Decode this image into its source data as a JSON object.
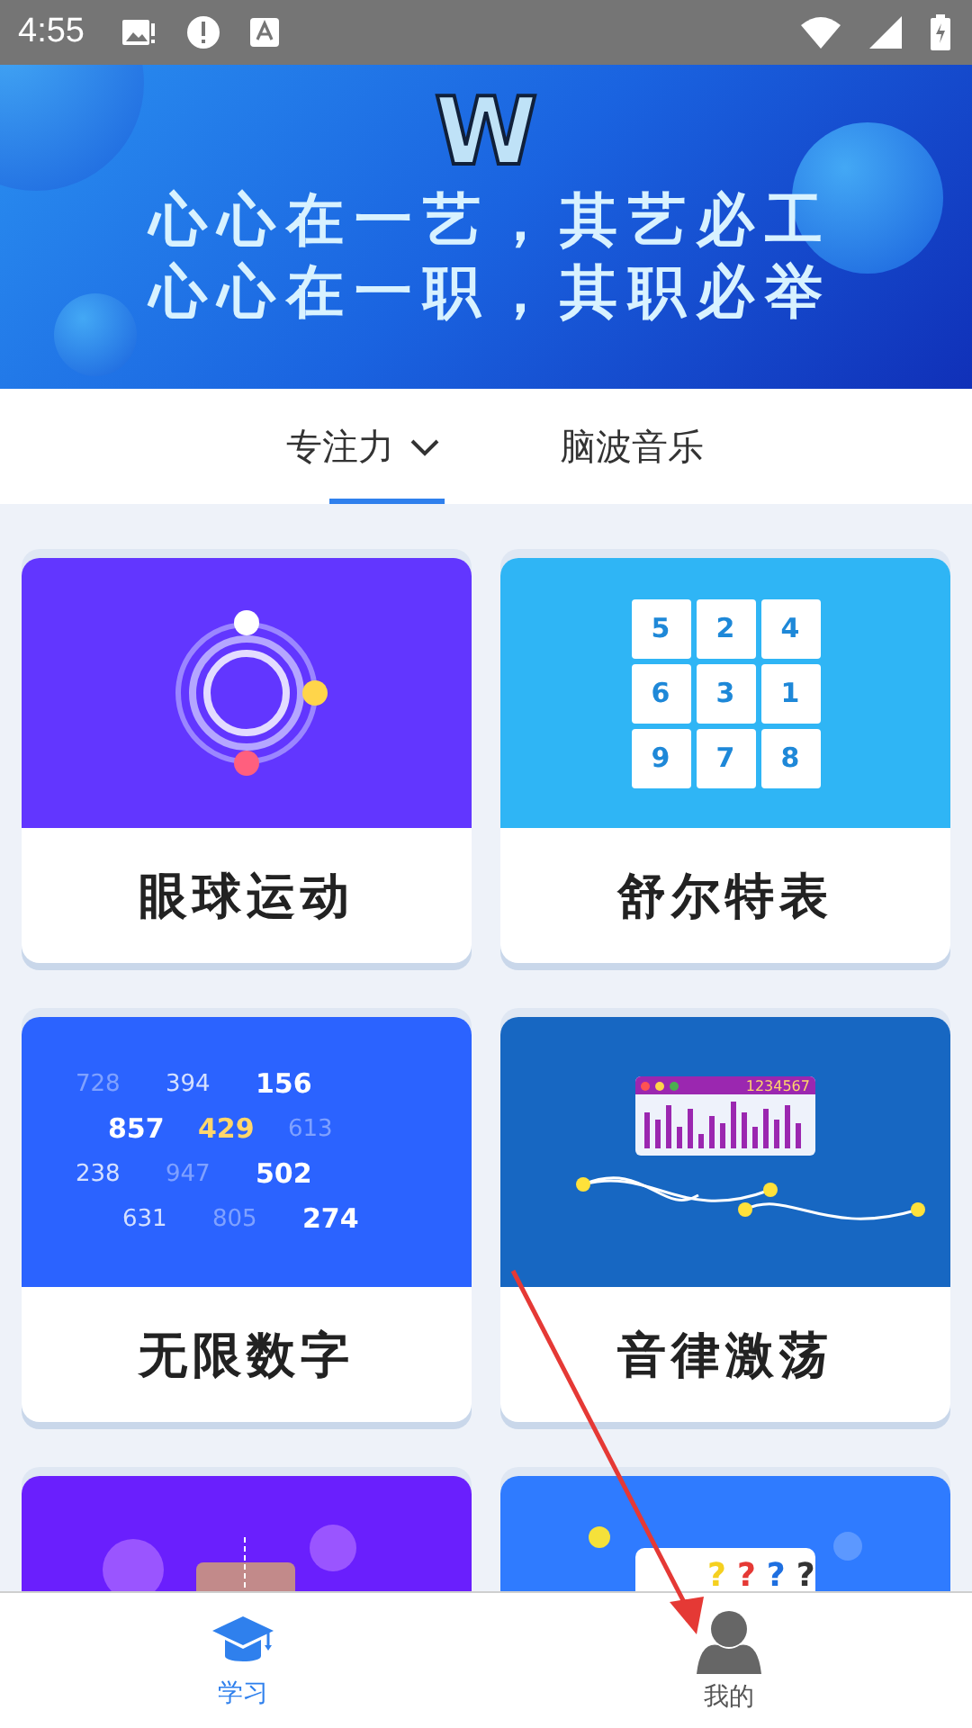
{
  "status_bar": {
    "time": "4:55"
  },
  "banner": {
    "logo": "W",
    "lines": [
      "心心在一艺，其艺必工",
      "心心在一职，其职必举"
    ]
  },
  "tabs": [
    {
      "label": "专注力",
      "selected": true,
      "dropdown": true
    },
    {
      "label": "脑波音乐",
      "selected": false,
      "dropdown": false
    }
  ],
  "cards": [
    {
      "kind": "orbit",
      "title": "眼球运动"
    },
    {
      "kind": "grid",
      "title": "舒尔特表",
      "numbers": [
        "5",
        "2",
        "4",
        "6",
        "3",
        "1",
        "9",
        "7",
        "8"
      ]
    },
    {
      "kind": "numbers",
      "title": "无限数字",
      "rows": [
        [
          {
            "text": "728",
            "kind": "faint"
          },
          {
            "text": "394",
            "kind": "mid"
          },
          {
            "text": "156",
            "kind": "bold"
          }
        ],
        [
          {
            "text": "857",
            "kind": "bold"
          },
          {
            "text": "429",
            "kind": "gold"
          },
          {
            "text": "613",
            "kind": "faint"
          }
        ],
        [
          {
            "text": "238",
            "kind": "mid"
          },
          {
            "text": "947",
            "kind": "faint"
          },
          {
            "text": "502",
            "kind": "bold"
          }
        ],
        [
          {
            "text": "631",
            "kind": "mid"
          },
          {
            "text": "805",
            "kind": "faint"
          },
          {
            "text": "274",
            "kind": "bold"
          }
        ]
      ]
    },
    {
      "kind": "rhythm",
      "title": "音律激荡",
      "label": "1234567"
    },
    {
      "kind": "shapes"
    },
    {
      "kind": "quiz",
      "marks": [
        {
          "text": "?",
          "color": "#f5d020"
        },
        {
          "text": "?",
          "color": "#e53935"
        },
        {
          "text": "?",
          "color": "#1e6fe0"
        },
        {
          "text": "?",
          "color": "#333333"
        }
      ]
    }
  ],
  "bottom_nav": [
    {
      "label": "学习",
      "selected": true
    },
    {
      "label": "我的",
      "selected": false
    }
  ]
}
